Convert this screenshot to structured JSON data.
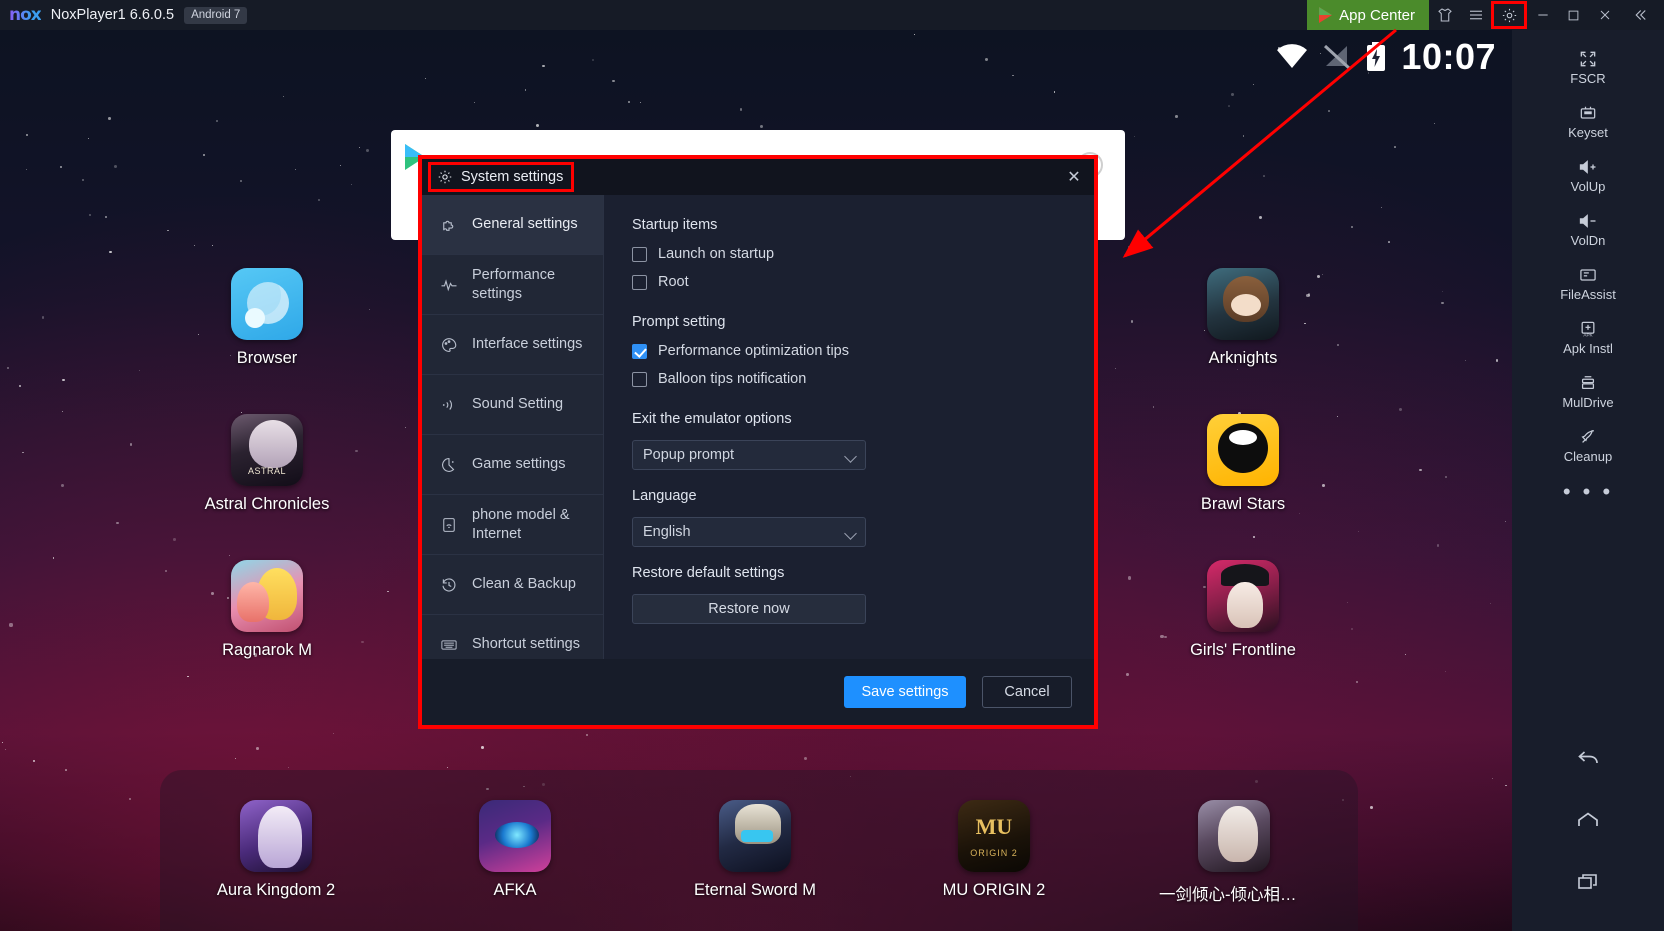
{
  "titlebar": {
    "logo": "nox",
    "app_title": "NoxPlayer1 6.6.0.5",
    "android_badge": "Android 7",
    "app_center_label": "App Center",
    "buttons": {
      "tshirt": "tshirt-icon",
      "menu": "hamburger-menu-icon",
      "settings": "gear-icon",
      "minimize": "minimize-icon",
      "maximize": "maximize-icon",
      "close": "close-icon",
      "collapse": "collapse-icon"
    }
  },
  "status_bar": {
    "wifi": "wifi-icon",
    "signal": "signal-off-icon",
    "battery": "battery-charging-icon",
    "clock": "10:07"
  },
  "desktop": {
    "left_column": [
      {
        "label": "Browser",
        "art": "t-browser"
      },
      {
        "label": "Astral Chronicles",
        "art": "t-astral"
      },
      {
        "label": "Ragnarok M",
        "art": "t-ragna"
      }
    ],
    "right_column": [
      {
        "label": "Arknights",
        "art": "t-ark"
      },
      {
        "label": "Brawl Stars",
        "art": "t-brawl"
      },
      {
        "label": "Girls' Frontline",
        "art": "t-girls"
      }
    ],
    "dock": [
      {
        "label": "Aura Kingdom 2",
        "art": "t-aura"
      },
      {
        "label": "AFKA",
        "art": "t-afka"
      },
      {
        "label": "Eternal Sword M",
        "art": "t-eternal"
      },
      {
        "label": "MU ORIGIN 2",
        "art": "t-mu"
      },
      {
        "label": "一剑倾心-倾心相遇， ...",
        "art": "t-jian"
      }
    ]
  },
  "right_toolbar": {
    "items": [
      {
        "label": "FSCR",
        "icon": "fullscreen-icon"
      },
      {
        "label": "Keyset",
        "icon": "keyset-icon"
      },
      {
        "label": "VolUp",
        "icon": "volume-up-icon"
      },
      {
        "label": "VolDn",
        "icon": "volume-down-icon"
      },
      {
        "label": "FileAssist",
        "icon": "file-assist-icon"
      },
      {
        "label": "Apk Instl",
        "icon": "apk-install-icon"
      },
      {
        "label": "MulDrive",
        "icon": "multi-drive-icon"
      },
      {
        "label": "Cleanup",
        "icon": "cleanup-rocket-icon"
      }
    ],
    "more": "• • •",
    "nav": {
      "back": "back-icon",
      "home": "home-icon",
      "recents": "recents-icon"
    }
  },
  "dialog": {
    "title": "System settings",
    "close": "✕",
    "nav_items": [
      {
        "label": "General settings",
        "icon": "puzzle-icon",
        "active": true
      },
      {
        "label": "Performance settings",
        "icon": "waveform-icon",
        "active": false
      },
      {
        "label": "Interface settings",
        "icon": "palette-icon",
        "active": false
      },
      {
        "label": "Sound Setting",
        "icon": "sound-wave-icon",
        "active": false
      },
      {
        "label": "Game settings",
        "icon": "game-icon",
        "active": false
      },
      {
        "label": "phone model & Internet",
        "icon": "phone-wifi-icon",
        "active": false
      },
      {
        "label": "Clean & Backup",
        "icon": "history-icon",
        "active": false
      },
      {
        "label": "Shortcut settings",
        "icon": "keyboard-icon",
        "active": false
      }
    ],
    "content": {
      "startup_title": "Startup items",
      "startup_items": [
        {
          "label": "Launch on startup",
          "checked": false
        },
        {
          "label": "Root",
          "checked": false
        }
      ],
      "prompt_title": "Prompt setting",
      "prompt_items": [
        {
          "label": "Performance optimization tips",
          "checked": true
        },
        {
          "label": "Balloon tips notification",
          "checked": false
        }
      ],
      "exit_title": "Exit the emulator options",
      "exit_value": "Popup prompt",
      "language_title": "Language",
      "language_value": "English",
      "restore_title": "Restore default settings",
      "restore_button": "Restore now"
    },
    "footer": {
      "save_label": "Save settings",
      "cancel_label": "Cancel"
    }
  },
  "colors": {
    "accent_blue": "#1e90ff",
    "app_center_green": "#4b8b2b",
    "annotation_red": "#ff0000",
    "checkbox_checked": "#2f90f5"
  }
}
